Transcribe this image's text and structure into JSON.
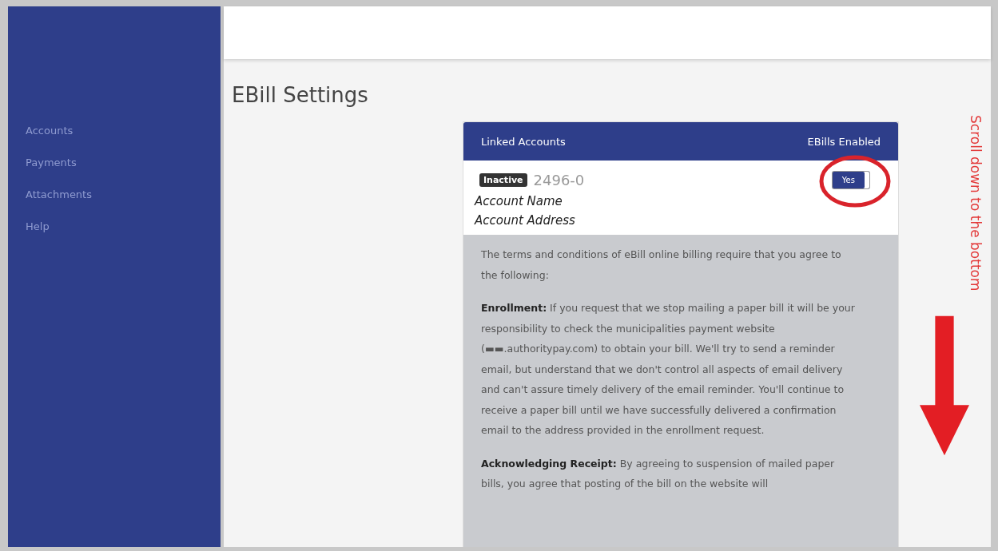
{
  "sidebar": {
    "items": [
      {
        "label": "Accounts"
      },
      {
        "label": "Payments"
      },
      {
        "label": "Attachments"
      },
      {
        "label": "Help"
      }
    ]
  },
  "page_title": "EBill Settings",
  "card": {
    "header": {
      "left": "Linked Accounts",
      "right": "EBills Enabled"
    },
    "account": {
      "status": "Inactive",
      "number": "2496-0",
      "name": "Account Name",
      "address": "Account Address",
      "ebill_toggle": {
        "label": "Yes",
        "on": true
      }
    },
    "terms": [
      {
        "text": "The terms and conditions of eBill online billing require that you agree to the following:"
      },
      {
        "heading": "Enrollment:",
        "text": "If you request that we stop mailing a paper bill it will be your responsibility to check the municipalities payment website (▬▬.authoritypay.com) to obtain your bill. We'll try to send a reminder email, but understand that we don't control all aspects of email delivery and can't assure timely delivery of the email reminder. You'll continue to receive a paper bill until we have successfully delivered a confirmation email to the address provided in the enrollment request."
      },
      {
        "heading": "Acknowledging Receipt:",
        "text": "By agreeing to suspension of mailed paper bills, you agree that posting of the bill on the website will"
      }
    ]
  },
  "annotation": {
    "text": "Scroll down to the bottom"
  }
}
